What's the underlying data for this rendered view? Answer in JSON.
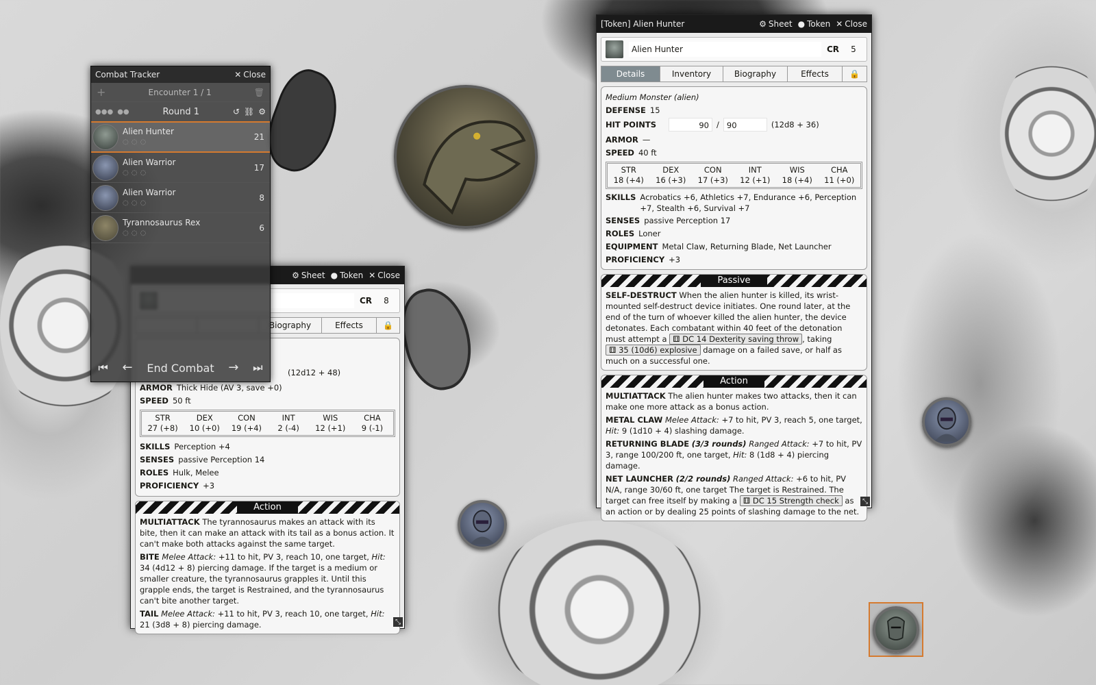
{
  "combat_tracker": {
    "title": "Combat Tracker",
    "close": "Close",
    "encounter": "Encounter 1 / 1",
    "round": "Round 1",
    "end_combat": "End Combat",
    "combatants": [
      {
        "name": "Alien Hunter",
        "initiative": "21"
      },
      {
        "name": "Alien Warrior",
        "initiative": "17"
      },
      {
        "name": "Alien Warrior",
        "initiative": "8"
      },
      {
        "name": "Tyrannosaurus Rex",
        "initiative": "6"
      }
    ]
  },
  "hunter_sheet": {
    "title": "[Token] Alien Hunter",
    "btn_sheet": "Sheet",
    "btn_token": "Token",
    "btn_close": "Close",
    "name": "Alien Hunter",
    "cr_label": "CR",
    "cr": "5",
    "tabs": [
      "Details",
      "Inventory",
      "Biography",
      "Effects"
    ],
    "type": "Medium Monster (alien)",
    "defense_label": "DEFENSE",
    "defense": "15",
    "hp_label": "HIT POINTS",
    "hp": "90",
    "hp_sep": "/",
    "hp_max": "90",
    "hp_formula": "(12d8 + 36)",
    "armor_label": "ARMOR",
    "armor": "—",
    "speed_label": "SPEED",
    "speed": "40 ft",
    "abilities": [
      {
        "name": "STR",
        "value": "18 (+4)"
      },
      {
        "name": "DEX",
        "value": "16 (+3)"
      },
      {
        "name": "CON",
        "value": "17 (+3)"
      },
      {
        "name": "INT",
        "value": "12 (+1)"
      },
      {
        "name": "WIS",
        "value": "18 (+4)"
      },
      {
        "name": "CHA",
        "value": "11 (+0)"
      }
    ],
    "skills_label": "SKILLS",
    "skills": "Acrobatics +6, Athletics +7, Endurance +6, Perception +7, Stealth +6, Survival +7",
    "senses_label": "SENSES",
    "senses": "passive Perception 17",
    "roles_label": "ROLES",
    "roles": "Loner",
    "equipment_label": "EQUIPMENT",
    "equipment": "Metal Claw, Returning Blade, Net Launcher",
    "proficiency_label": "PROFICIENCY",
    "proficiency": "+3",
    "passive_title": "Passive",
    "sd_name": "SELF-DESTRUCT",
    "sd_text": "When the alien hunter is killed, its wrist-mounted self-destruct device initiates. One round later, at the end of the turn of whoever killed the alien hunter, the device detonates. Each combatant within 40 feet of the detonation must attempt a",
    "sd_roll1": "DC 14 Dexterity saving throw",
    "sd_mid": ", taking",
    "sd_roll2": "35 (10d6) explosive",
    "sd_end": "damage on a failed save, or half as much on a successful one.",
    "action_title": "Action",
    "ma_name": "MULTIATTACK",
    "ma_text": "The alien hunter makes two attacks, then it can make one more attack as a bonus action.",
    "mc_name": "METAL CLAW",
    "mc_type": "Melee Attack:",
    "mc_text": "+7 to hit, PV 3, reach 5, one target,",
    "mc_hit": "Hit:",
    "mc_dmg": "9 (1d10 + 4) slashing damage.",
    "rb_name": "RETURNING BLADE",
    "rb_uses": "(3/3 rounds)",
    "rb_type": "Ranged Attack:",
    "rb_text": "+7 to hit, PV 3, range 100/200 ft, one target,",
    "rb_hit": "Hit:",
    "rb_dmg": "8 (1d8 + 4) piercing damage.",
    "nl_name": "NET LAUNCHER",
    "nl_uses": "(2/2 rounds)",
    "nl_type": "Ranged Attack:",
    "nl_text": "+6 to hit, PV N/A, range 30/60 ft, one target The target is Restrained. The target can free itself by making a",
    "nl_roll": "DC 15 Strength check",
    "nl_end": "as an action or by dealing 25 points of slashing damage to the net."
  },
  "rex_sheet": {
    "btn_sheet": "Sheet",
    "btn_token": "Token",
    "btn_close": "Close",
    "cr_label": "CR",
    "cr": "8",
    "tabs": [
      "Biography",
      "Effects"
    ],
    "hp_formula": "(12d12 + 48)",
    "armor_label": "ARMOR",
    "armor": "Thick Hide (AV 3, save +0)",
    "speed_label": "SPEED",
    "speed": "50 ft",
    "abilities": [
      {
        "name": "STR",
        "value": "27 (+8)"
      },
      {
        "name": "DEX",
        "value": "10 (+0)"
      },
      {
        "name": "CON",
        "value": "19 (+4)"
      },
      {
        "name": "INT",
        "value": "2 (-4)"
      },
      {
        "name": "WIS",
        "value": "12 (+1)"
      },
      {
        "name": "CHA",
        "value": "9 (-1)"
      }
    ],
    "skills_label": "SKILLS",
    "skills": "Perception +4",
    "senses_label": "SENSES",
    "senses": "passive Perception 14",
    "roles_label": "ROLES",
    "roles": "Hulk, Melee",
    "proficiency_label": "PROFICIENCY",
    "proficiency": "+3",
    "action_title": "Action",
    "ma_name": "MULTIATTACK",
    "ma_text": "The tyrannosaurus makes an attack with its bite, then it can make an attack with its tail as a bonus action. It can't make both attacks against the same target.",
    "bite_name": "BITE",
    "bite_type": "Melee Attack:",
    "bite_text": "+11 to hit, PV 3, reach 10, one target,",
    "bite_hit": "Hit:",
    "bite_dmg": "34 (4d12 + 8) piercing damage. If the target is a medium or smaller creature, the tyrannosaurus grapples it. Until this grapple ends, the target is Restrained, and the tyrannosaurus can't bite another target.",
    "tail_name": "TAIL",
    "tail_type": "Melee Attack:",
    "tail_text": "+11 to hit, PV 3, reach 10, one target,",
    "tail_hit": "Hit:",
    "tail_dmg": "21 (3d8 + 8) piercing damage."
  },
  "icons": {
    "close": "✕",
    "gear": "⚙",
    "user": "●",
    "plus": "+",
    "trash": "🗑",
    "undo": "↺",
    "link": "⛓",
    "lock": "🔒",
    "first": "⏮",
    "prev": "←",
    "next": "→",
    "last": "⏭",
    "resize": "⤡",
    "dice": "⚅"
  },
  "colors": {
    "accent": "#d57a2f",
    "tab_active": "#7f8b90",
    "header": "#1a1a1a"
  }
}
